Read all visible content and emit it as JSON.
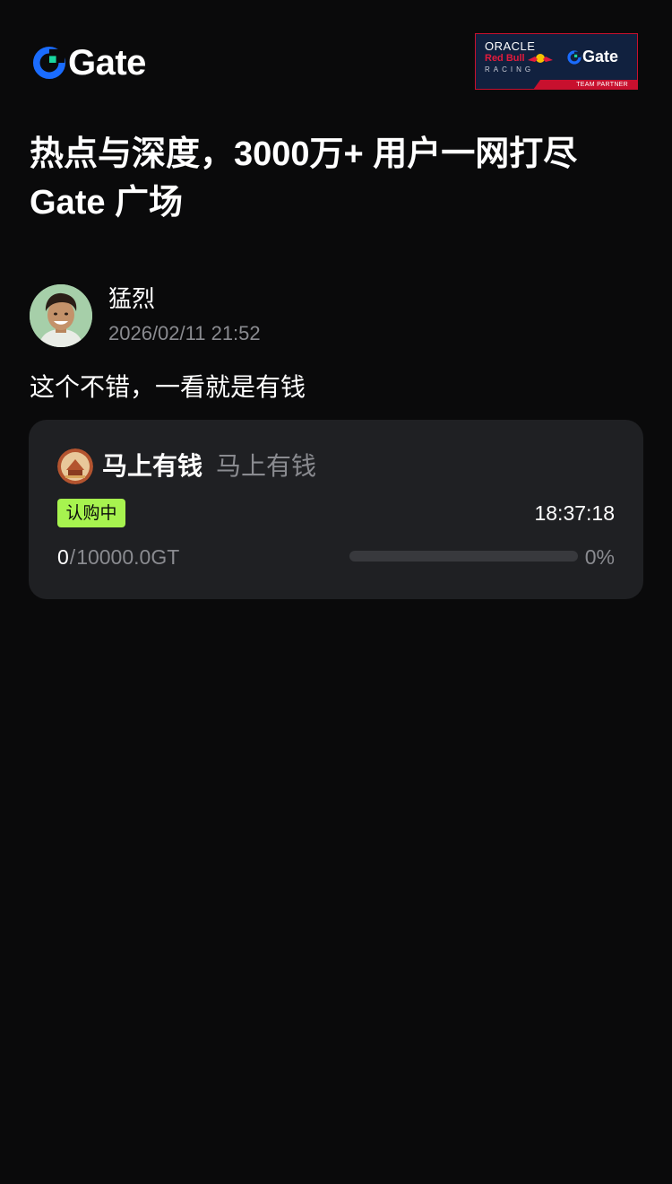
{
  "header": {
    "logo_text": "Gate",
    "partner": {
      "oracle": "ORACLE",
      "redbull": "Red Bull",
      "racing": "RACING",
      "gate": "Gate",
      "tag": "TEAM PARTNER"
    }
  },
  "headline": {
    "line1": "热点与深度，3000万+ 用户一网打尽",
    "line2": "Gate 广场"
  },
  "post": {
    "author": "猛烈",
    "time": "2026/02/11 21:52",
    "body": "这个不错，一看就是有钱"
  },
  "card": {
    "token_name": "马上有钱",
    "token_symbol": "马上有钱",
    "status": "认购中",
    "countdown": "18:37:18",
    "raised": "0",
    "separator": "/",
    "goal": "10000.0GT",
    "progress_fraction": 0,
    "progress_label": "0%"
  },
  "colors": {
    "background": "#0a0a0b",
    "card": "#1f2023",
    "accent_green": "#a7f34f",
    "brand_blue": "#1a6cff",
    "muted_text": "#8a8b90"
  }
}
